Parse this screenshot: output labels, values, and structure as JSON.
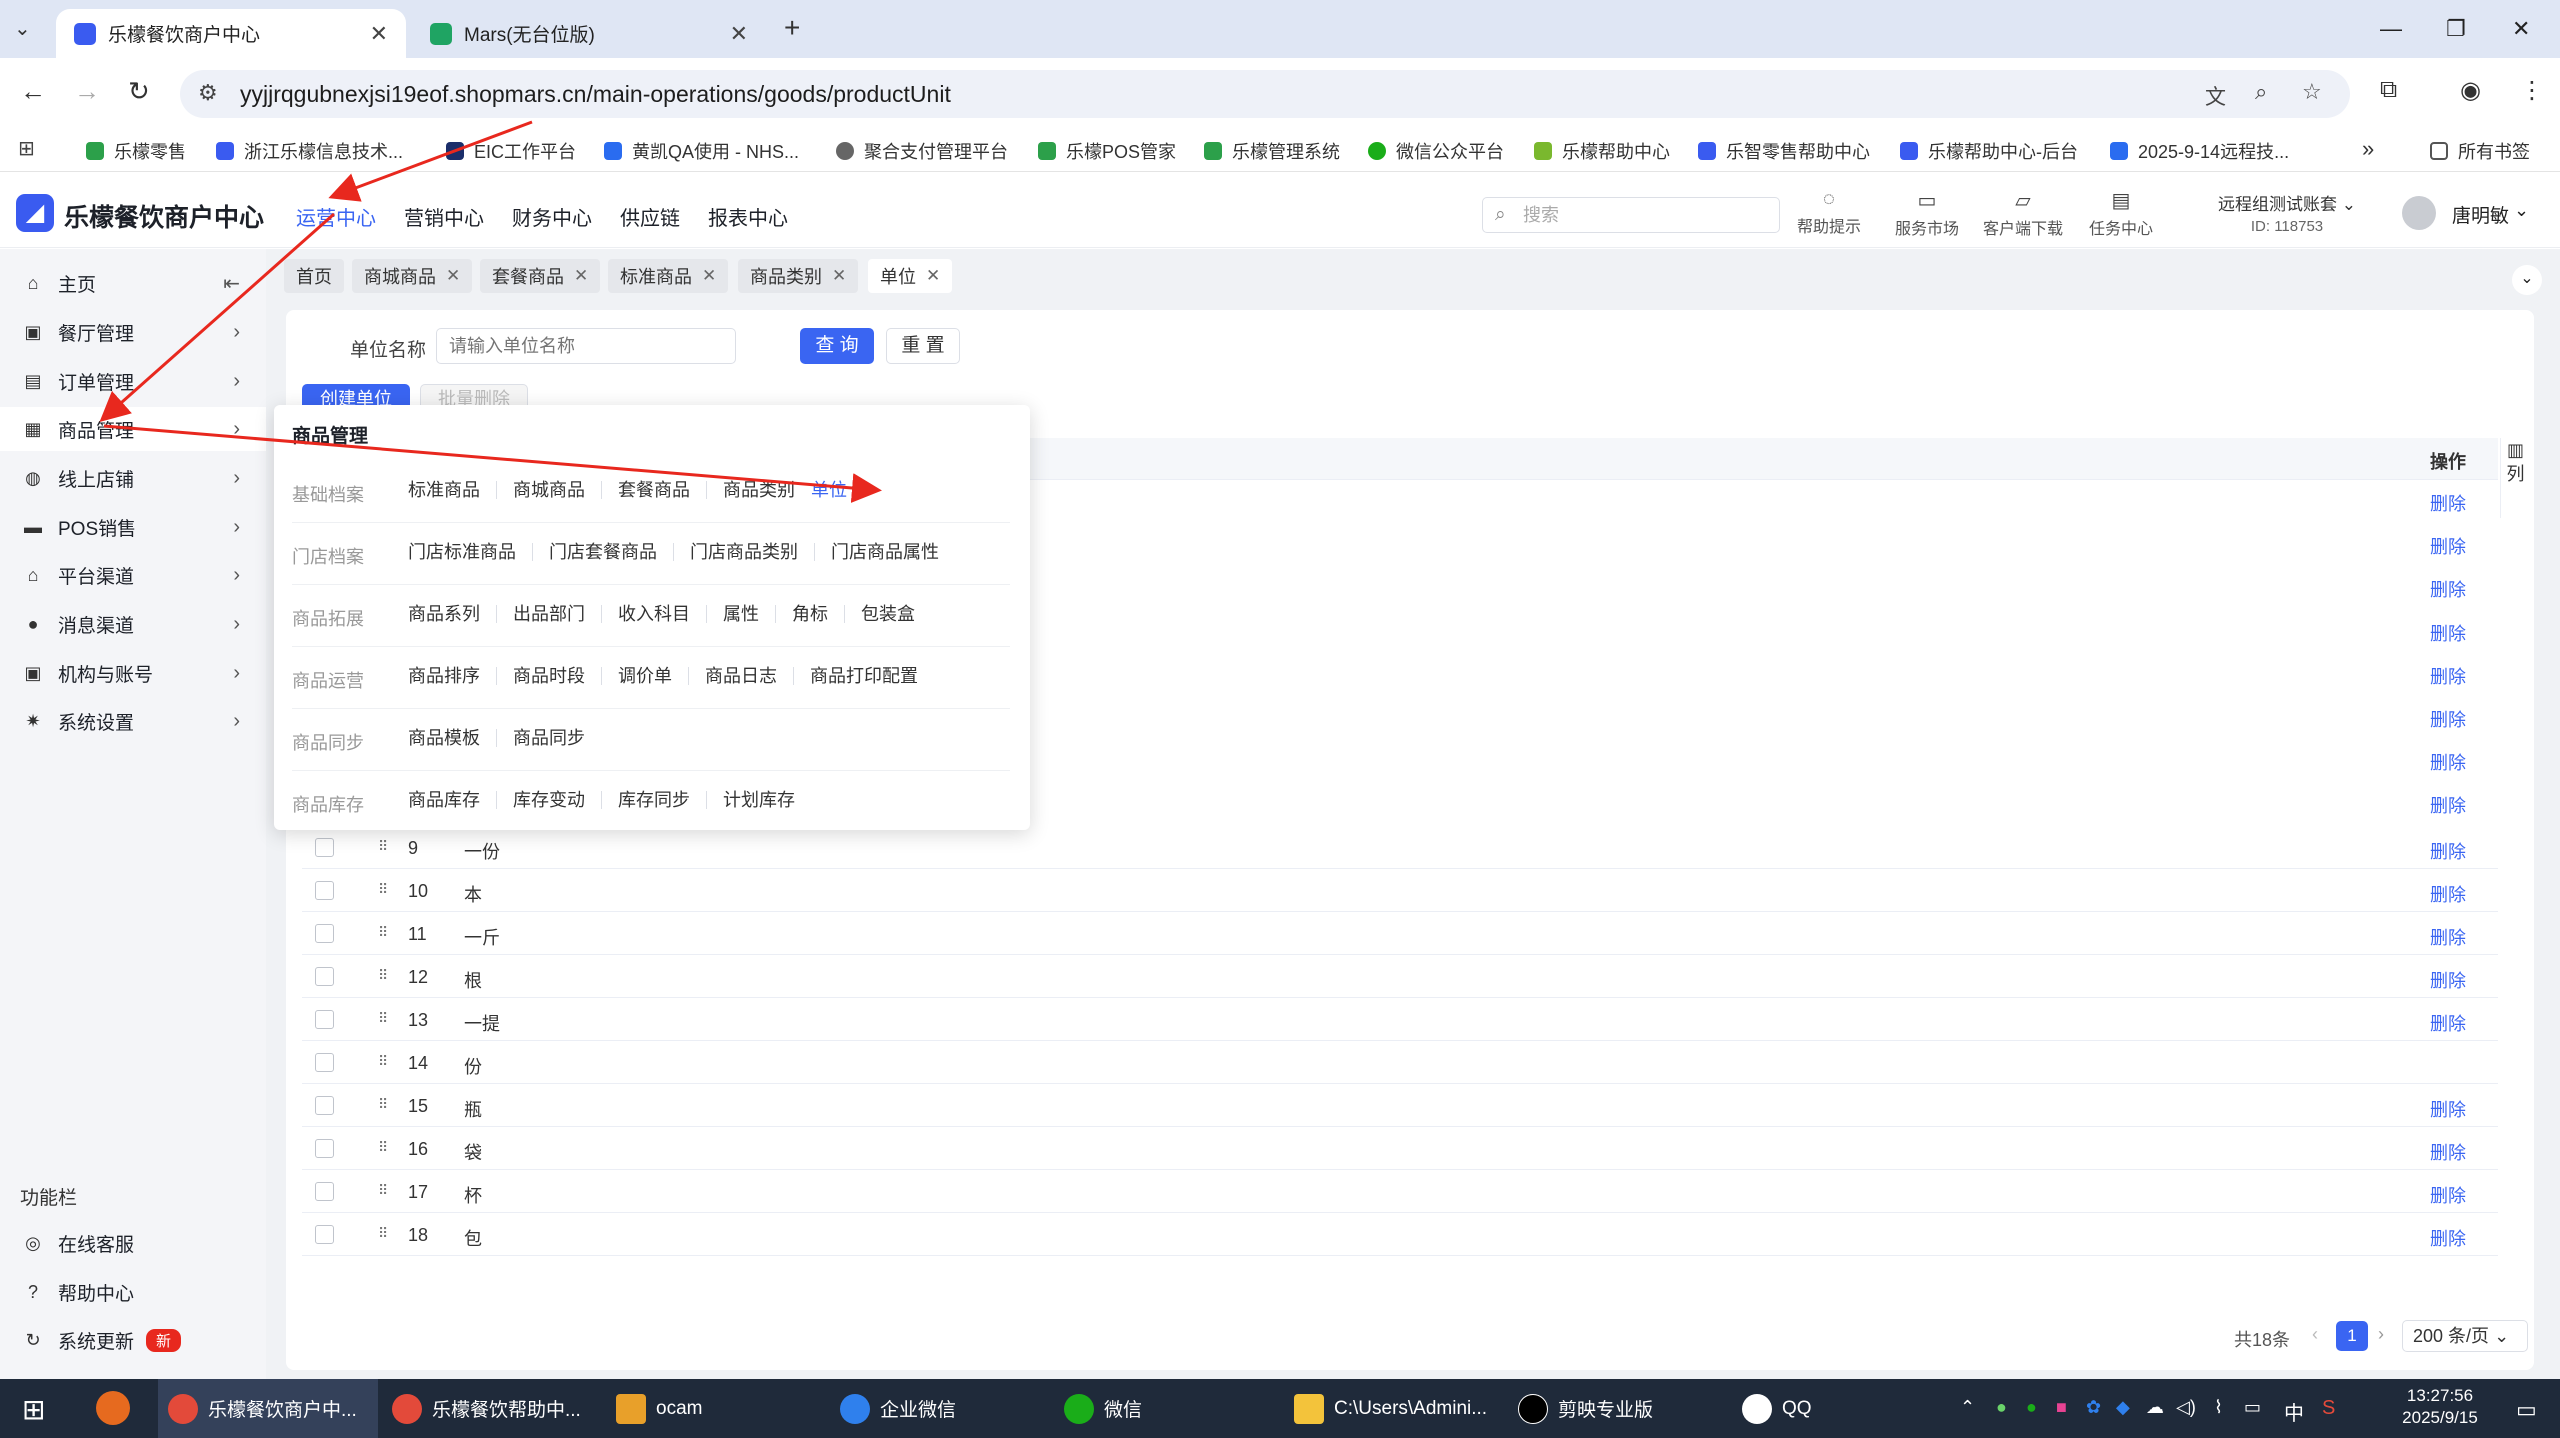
{
  "browser": {
    "tabs": [
      {
        "title": "乐檬餐饮商户中心",
        "close": "✕"
      },
      {
        "title": "Mars(无台位版)",
        "close": "✕"
      }
    ],
    "new_tab": "+",
    "url": "yyjjrqgubnexjsi19eof.shopmars.cn/main-operations/goods/productUnit",
    "bookmarks": [
      "乐檬零售",
      "浙江乐檬信息技术...",
      "EIC工作平台",
      "黄凯QA使用 - NHS...",
      "聚合支付管理平台",
      "乐檬POS管家",
      "乐檬管理系统",
      "微信公众平台",
      "乐檬帮助中心",
      "乐智零售帮助中心",
      "乐檬帮助中心-后台",
      "2025-9-14远程技..."
    ],
    "bookmarks_more": "»",
    "all_bookmarks": "所有书签"
  },
  "app": {
    "title": "乐檬餐饮商户中心",
    "logo_glyph": "◢",
    "topnav": [
      "运营中心",
      "营销中心",
      "财务中心",
      "供应链",
      "报表中心"
    ],
    "search_placeholder": "搜索",
    "header_icons": [
      "帮助提示",
      "服务市场",
      "客户端下载",
      "任务中心"
    ],
    "account": {
      "name": "远程组测试账套",
      "id": "ID: 118753"
    },
    "user": "唐明敏"
  },
  "sidebar": {
    "items": [
      "主页",
      "餐厅管理",
      "订单管理",
      "商品管理",
      "线上店铺",
      "POS销售",
      "平台渠道",
      "消息渠道",
      "机构与账号",
      "系统设置"
    ],
    "func_title": "功能栏",
    "func_items": [
      "在线客服",
      "帮助中心",
      "系统更新"
    ],
    "new_badge": "新"
  },
  "page_tabs": [
    "首页",
    "商城商品",
    "套餐商品",
    "标准商品",
    "商品类别",
    "单位"
  ],
  "filter": {
    "label": "单位名称",
    "placeholder": "请输入单位名称",
    "query": "查 询",
    "reset": "重 置"
  },
  "actions": {
    "create": "创建单位",
    "batch_delete": "批量删除"
  },
  "table": {
    "op_header": "操作",
    "col_setting": "列",
    "delete_label": "删除",
    "rows": [
      {
        "no": "9",
        "name": "一份"
      },
      {
        "no": "10",
        "name": "本"
      },
      {
        "no": "11",
        "name": "一斤"
      },
      {
        "no": "12",
        "name": "根"
      },
      {
        "no": "13",
        "name": "一提"
      },
      {
        "no": "14",
        "name": "份"
      },
      {
        "no": "15",
        "name": "瓶"
      },
      {
        "no": "16",
        "name": "袋"
      },
      {
        "no": "17",
        "name": "杯"
      },
      {
        "no": "18",
        "name": "包"
      }
    ]
  },
  "popup": {
    "title": "商品管理",
    "groups": [
      {
        "cat": "基础档案",
        "links": [
          "标准商品",
          "商城商品",
          "套餐商品",
          "商品类别",
          "单位"
        ]
      },
      {
        "cat": "门店档案",
        "links": [
          "门店标准商品",
          "门店套餐商品",
          "门店商品类别",
          "门店商品属性"
        ]
      },
      {
        "cat": "商品拓展",
        "links": [
          "商品系列",
          "出品部门",
          "收入科目",
          "属性",
          "角标",
          "包装盒"
        ]
      },
      {
        "cat": "商品运营",
        "links": [
          "商品排序",
          "商品时段",
          "调价单",
          "商品日志",
          "商品打印配置"
        ]
      },
      {
        "cat": "商品同步",
        "links": [
          "商品模板",
          "商品同步"
        ]
      },
      {
        "cat": "商品库存",
        "links": [
          "商品库存",
          "库存变动",
          "库存同步",
          "计划库存"
        ]
      }
    ]
  },
  "pagination": {
    "total": "共18条",
    "current": "1",
    "page_size": "200 条/页"
  },
  "taskbar": {
    "items": [
      "乐檬餐饮商户中...",
      "乐檬餐饮帮助中...",
      "ocam",
      "企业微信",
      "微信",
      "C:\\Users\\Admini...",
      "剪映专业版",
      "QQ"
    ],
    "ime": "中",
    "time": "13:27:56",
    "date": "2025/9/15"
  },
  "colors": {
    "accent": "#3a65f2",
    "annotation": "#e8281e"
  }
}
